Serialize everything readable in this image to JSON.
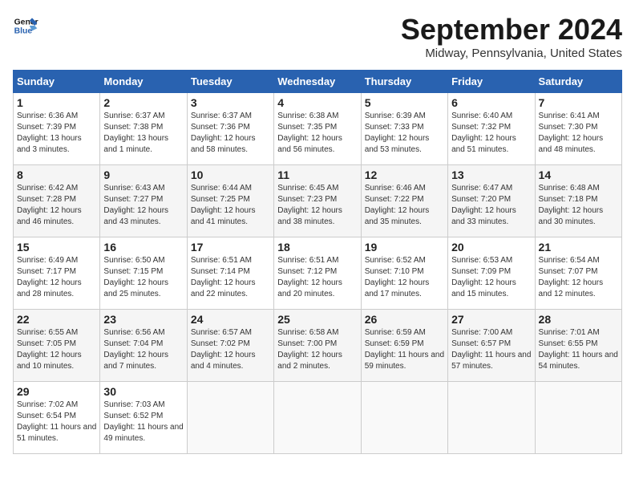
{
  "logo": {
    "line1": "General",
    "line2": "Blue"
  },
  "title": "September 2024",
  "location": "Midway, Pennsylvania, United States",
  "days_of_week": [
    "Sunday",
    "Monday",
    "Tuesday",
    "Wednesday",
    "Thursday",
    "Friday",
    "Saturday"
  ],
  "weeks": [
    [
      {
        "day": "1",
        "sunrise": "6:36 AM",
        "sunset": "7:39 PM",
        "daylight": "13 hours and 3 minutes."
      },
      {
        "day": "2",
        "sunrise": "6:37 AM",
        "sunset": "7:38 PM",
        "daylight": "13 hours and 1 minute."
      },
      {
        "day": "3",
        "sunrise": "6:37 AM",
        "sunset": "7:36 PM",
        "daylight": "12 hours and 58 minutes."
      },
      {
        "day": "4",
        "sunrise": "6:38 AM",
        "sunset": "7:35 PM",
        "daylight": "12 hours and 56 minutes."
      },
      {
        "day": "5",
        "sunrise": "6:39 AM",
        "sunset": "7:33 PM",
        "daylight": "12 hours and 53 minutes."
      },
      {
        "day": "6",
        "sunrise": "6:40 AM",
        "sunset": "7:32 PM",
        "daylight": "12 hours and 51 minutes."
      },
      {
        "day": "7",
        "sunrise": "6:41 AM",
        "sunset": "7:30 PM",
        "daylight": "12 hours and 48 minutes."
      }
    ],
    [
      {
        "day": "8",
        "sunrise": "6:42 AM",
        "sunset": "7:28 PM",
        "daylight": "12 hours and 46 minutes."
      },
      {
        "day": "9",
        "sunrise": "6:43 AM",
        "sunset": "7:27 PM",
        "daylight": "12 hours and 43 minutes."
      },
      {
        "day": "10",
        "sunrise": "6:44 AM",
        "sunset": "7:25 PM",
        "daylight": "12 hours and 41 minutes."
      },
      {
        "day": "11",
        "sunrise": "6:45 AM",
        "sunset": "7:23 PM",
        "daylight": "12 hours and 38 minutes."
      },
      {
        "day": "12",
        "sunrise": "6:46 AM",
        "sunset": "7:22 PM",
        "daylight": "12 hours and 35 minutes."
      },
      {
        "day": "13",
        "sunrise": "6:47 AM",
        "sunset": "7:20 PM",
        "daylight": "12 hours and 33 minutes."
      },
      {
        "day": "14",
        "sunrise": "6:48 AM",
        "sunset": "7:18 PM",
        "daylight": "12 hours and 30 minutes."
      }
    ],
    [
      {
        "day": "15",
        "sunrise": "6:49 AM",
        "sunset": "7:17 PM",
        "daylight": "12 hours and 28 minutes."
      },
      {
        "day": "16",
        "sunrise": "6:50 AM",
        "sunset": "7:15 PM",
        "daylight": "12 hours and 25 minutes."
      },
      {
        "day": "17",
        "sunrise": "6:51 AM",
        "sunset": "7:14 PM",
        "daylight": "12 hours and 22 minutes."
      },
      {
        "day": "18",
        "sunrise": "6:51 AM",
        "sunset": "7:12 PM",
        "daylight": "12 hours and 20 minutes."
      },
      {
        "day": "19",
        "sunrise": "6:52 AM",
        "sunset": "7:10 PM",
        "daylight": "12 hours and 17 minutes."
      },
      {
        "day": "20",
        "sunrise": "6:53 AM",
        "sunset": "7:09 PM",
        "daylight": "12 hours and 15 minutes."
      },
      {
        "day": "21",
        "sunrise": "6:54 AM",
        "sunset": "7:07 PM",
        "daylight": "12 hours and 12 minutes."
      }
    ],
    [
      {
        "day": "22",
        "sunrise": "6:55 AM",
        "sunset": "7:05 PM",
        "daylight": "12 hours and 10 minutes."
      },
      {
        "day": "23",
        "sunrise": "6:56 AM",
        "sunset": "7:04 PM",
        "daylight": "12 hours and 7 minutes."
      },
      {
        "day": "24",
        "sunrise": "6:57 AM",
        "sunset": "7:02 PM",
        "daylight": "12 hours and 4 minutes."
      },
      {
        "day": "25",
        "sunrise": "6:58 AM",
        "sunset": "7:00 PM",
        "daylight": "12 hours and 2 minutes."
      },
      {
        "day": "26",
        "sunrise": "6:59 AM",
        "sunset": "6:59 PM",
        "daylight": "11 hours and 59 minutes."
      },
      {
        "day": "27",
        "sunrise": "7:00 AM",
        "sunset": "6:57 PM",
        "daylight": "11 hours and 57 minutes."
      },
      {
        "day": "28",
        "sunrise": "7:01 AM",
        "sunset": "6:55 PM",
        "daylight": "11 hours and 54 minutes."
      }
    ],
    [
      {
        "day": "29",
        "sunrise": "7:02 AM",
        "sunset": "6:54 PM",
        "daylight": "11 hours and 51 minutes."
      },
      {
        "day": "30",
        "sunrise": "7:03 AM",
        "sunset": "6:52 PM",
        "daylight": "11 hours and 49 minutes."
      },
      null,
      null,
      null,
      null,
      null
    ]
  ],
  "labels": {
    "sunrise": "Sunrise:",
    "sunset": "Sunset:",
    "daylight": "Daylight:"
  }
}
